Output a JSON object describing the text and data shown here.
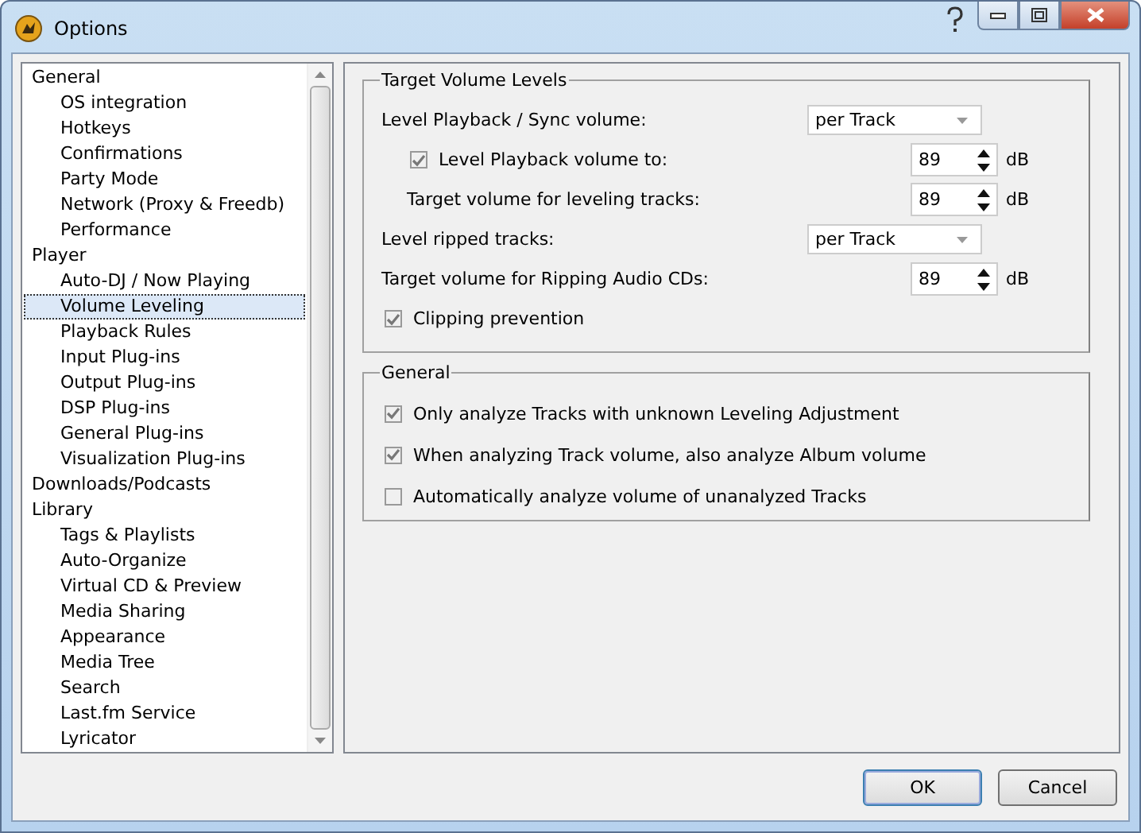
{
  "window": {
    "title": "Options"
  },
  "tree": [
    {
      "label": "General",
      "selected": false,
      "children": [
        {
          "label": "OS integration",
          "selected": false
        },
        {
          "label": "Hotkeys",
          "selected": false
        },
        {
          "label": "Confirmations",
          "selected": false
        },
        {
          "label": "Party Mode",
          "selected": false
        },
        {
          "label": "Network (Proxy & Freedb)",
          "selected": false
        },
        {
          "label": "Performance",
          "selected": false
        }
      ]
    },
    {
      "label": "Player",
      "selected": false,
      "children": [
        {
          "label": "Auto-DJ / Now Playing",
          "selected": false
        },
        {
          "label": "Volume Leveling",
          "selected": true
        },
        {
          "label": "Playback Rules",
          "selected": false
        },
        {
          "label": "Input Plug-ins",
          "selected": false
        },
        {
          "label": "Output Plug-ins",
          "selected": false
        },
        {
          "label": "DSP Plug-ins",
          "selected": false
        },
        {
          "label": "General Plug-ins",
          "selected": false
        },
        {
          "label": "Visualization Plug-ins",
          "selected": false
        }
      ]
    },
    {
      "label": "Downloads/Podcasts",
      "selected": false
    },
    {
      "label": "Library",
      "selected": false,
      "children": [
        {
          "label": "Tags & Playlists",
          "selected": false
        },
        {
          "label": "Auto-Organize",
          "selected": false
        },
        {
          "label": "Virtual CD & Preview",
          "selected": false
        },
        {
          "label": "Media Sharing",
          "selected": false
        },
        {
          "label": "Appearance",
          "selected": false
        },
        {
          "label": "Media Tree",
          "selected": false
        },
        {
          "label": "Search",
          "selected": false
        },
        {
          "label": "Last.fm Service",
          "selected": false
        },
        {
          "label": "Lyricator",
          "selected": false
        }
      ]
    }
  ],
  "groups": [
    {
      "title": "Target Volume Levels",
      "rows": [
        {
          "kind": "select",
          "label": "Level Playback / Sync volume:",
          "value": "per Track",
          "children": [
            {
              "kind": "check-spin",
              "label": "Level Playback volume to:",
              "checked": true,
              "value": "89",
              "unit": "dB"
            },
            {
              "kind": "spin",
              "label": "Target volume for leveling tracks:",
              "value": "89",
              "unit": "dB"
            }
          ]
        },
        {
          "kind": "select",
          "label": "Level ripped tracks:",
          "value": "per Track"
        },
        {
          "kind": "spin",
          "label": "Target volume for Ripping Audio CDs:",
          "value": "89",
          "unit": "dB"
        },
        {
          "kind": "check",
          "label": "Clipping prevention",
          "checked": true
        }
      ]
    },
    {
      "title": "General",
      "rows": [
        {
          "kind": "check",
          "label": "Only analyze Tracks with unknown Leveling Adjustment",
          "checked": true
        },
        {
          "kind": "check",
          "label": "When analyzing Track volume, also analyze Album volume",
          "checked": true
        },
        {
          "kind": "check",
          "label": "Automatically analyze volume of unanalyzed Tracks",
          "checked": false
        }
      ]
    }
  ],
  "buttons": [
    {
      "label": "OK",
      "default": true
    },
    {
      "label": "Cancel",
      "default": false
    }
  ]
}
